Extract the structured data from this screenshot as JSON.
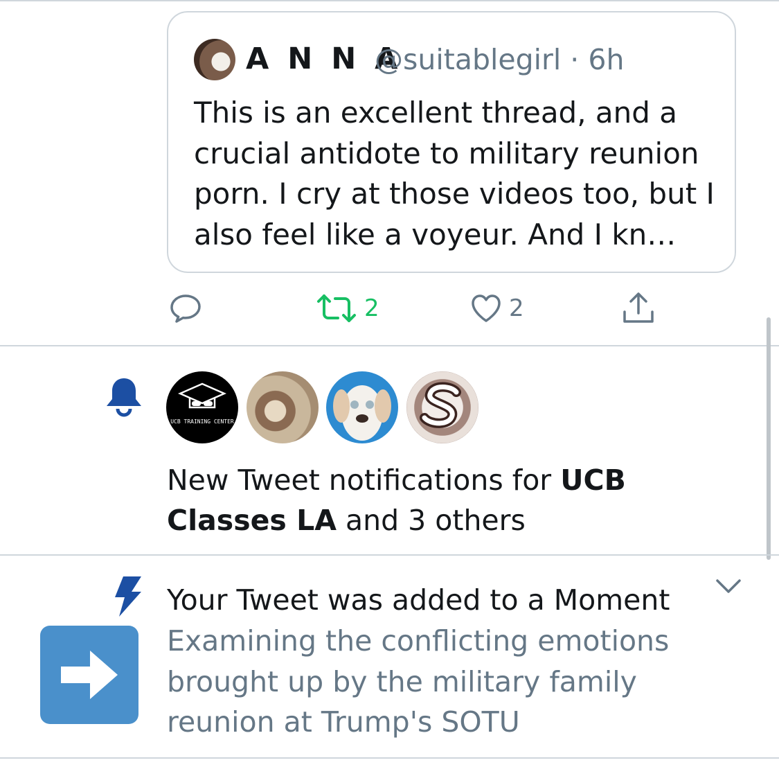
{
  "quoted_tweet": {
    "name": "A N N A",
    "handle": "@suitablegirl",
    "time": "6h",
    "text": "This is an excellent thread, and a crucial antidote to military reunion porn. I cry at those videos too, but I also feel like a voyeur. And I kn…"
  },
  "actions": {
    "reply_icon": "reply-icon",
    "retweet_icon": "retweet-icon",
    "retweet_count": "2",
    "like_icon": "heart-icon",
    "like_count": "2",
    "share_icon": "share-icon"
  },
  "notification": {
    "icon": "bell-icon",
    "avatars": [
      {
        "name": "ucb-training-center-avatar",
        "text": "UCB TRAINING CENTER"
      },
      {
        "name": "painting-avatar"
      },
      {
        "name": "dog-avatar"
      },
      {
        "name": "s-logo-avatar"
      }
    ],
    "text_prefix": "New Tweet notifications for ",
    "text_bold": "UCB Classes LA",
    "text_suffix": " and 3 others"
  },
  "moment": {
    "icon": "lightning-icon",
    "title": "Your Tweet was added to a Moment",
    "description": "Examining the conflicting emotions brought up by the military family reunion at Trump's SOTU",
    "thumbnail_icon": "arrow-right-icon",
    "menu_icon": "chevron-down-icon"
  },
  "colors": {
    "accent_blue": "#1da1f2",
    "bell_blue": "#1c4fa3",
    "retweet_green": "#17bf63",
    "secondary_text": "#657786",
    "divider": "#cfd6dc",
    "thumbnail_blue": "#4a90cb"
  }
}
